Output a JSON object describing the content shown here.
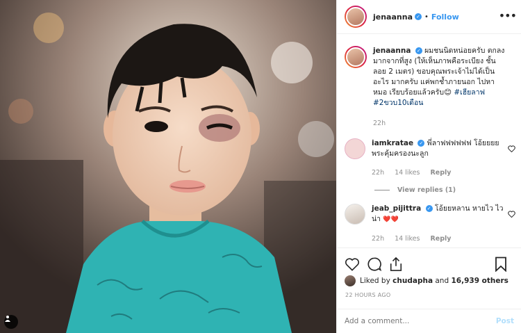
{
  "post": {
    "author": "jenaanna",
    "follow_label": "Follow",
    "dot": "•",
    "more_icon": "more-options-icon"
  },
  "caption": {
    "username": "jenaanna",
    "text": "ผมชนนิดหน่อยครับ ตกลง มากจากที่สูง (ให้เห็นภาพคือระเบียง ชั้นลอย 2 เมตร) ขอบคุณพระเจ้าไม่ได้เป็นอะไร มากครับ แค่พกช้ำภายนอก ไปหาหมอ เรียบร้อยแล้วครับ",
    "emoji": "😊",
    "hashtag1": "#เฮียลาฟ",
    "hashtag2": "#2ขวบ10เดือน",
    "time": "22h"
  },
  "comments": [
    {
      "username": "iamkratae",
      "text": "พี่ลาฟฟฟฟฟฟ โอ้ยยยย พระคุ้มครองนะลูก",
      "time": "22h",
      "likes": "14 likes",
      "reply": "Reply",
      "view_replies": "View replies (1)"
    },
    {
      "username": "jeab_pijittra",
      "text": "โอ้ยยหลาน หายไว ไวน่า",
      "hearts": "❤️❤️",
      "time": "22h",
      "likes": "14 likes",
      "reply": "Reply"
    }
  ],
  "likes": {
    "prefix": "Liked by",
    "user": "chudapha",
    "and": "and",
    "count": "16,939 others"
  },
  "timestamp": "22 HOURS AGO",
  "comment_box": {
    "placeholder": "Add a comment...",
    "post_label": "Post"
  },
  "colors": {
    "link_blue": "#3897f0",
    "hashtag": "#003569",
    "muted": "#8e8e8e",
    "post_disabled": "#b2dffc",
    "shirt": "#2fb3b3"
  }
}
